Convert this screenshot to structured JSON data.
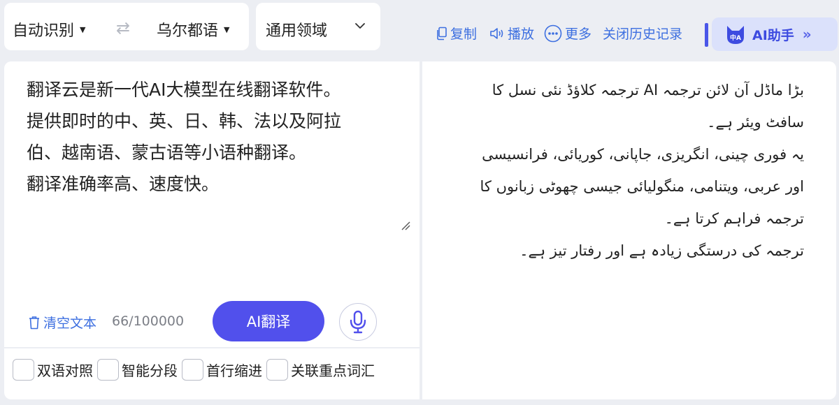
{
  "language_bar": {
    "source_language": "自动识别",
    "target_language": "乌尔都语",
    "swap_icon": "swap-arrows-icon"
  },
  "domain": {
    "label": "通用领域",
    "icon": "chevron-down-icon"
  },
  "toolbar": {
    "copy_label": "复制",
    "play_label": "播放",
    "more_label": "更多",
    "close_history_label": "关闭历史记录",
    "ai_assistant_label": "AI助手",
    "ai_assistant_mascot_text": "中A"
  },
  "source": {
    "lines": [
      "翻译云是新一代AI大模型在线翻译软件。",
      "提供即时的中、英、日、韩、法以及阿拉",
      "伯、越南语、蒙古语等小语种翻译。",
      "翻译准确率高、速度快。"
    ],
    "clear_label": "清空文本",
    "char_count": "66/100000",
    "translate_label": "AI翻译"
  },
  "options": [
    {
      "label": "双语对照",
      "checked": false
    },
    {
      "label": "智能分段",
      "checked": false
    },
    {
      "label": "首行缩进",
      "checked": false
    },
    {
      "label": "关联重点词汇",
      "checked": false
    }
  ],
  "target": {
    "lines": [
      "بڑا ماڈل آن لائن ترجمہ AI ترجمہ کلاؤڈ نئی نسل کا",
      "سافٹ ویئر ہے۔",
      "یہ فوری چینی، انگریزی، جاپانی، کوریائی، فرانسیسی",
      "اور عربی، ویتنامی، منگولیائی جیسی چھوٹی زبانوں کا",
      "ترجمہ فراہم کرتا ہے۔",
      "ترجمہ کی درستگی زیادہ ہے اور رفتار تیز ہے۔"
    ]
  },
  "colors": {
    "accent": "#5150ec",
    "link": "#3d6fe0",
    "background": "#eceef3"
  }
}
